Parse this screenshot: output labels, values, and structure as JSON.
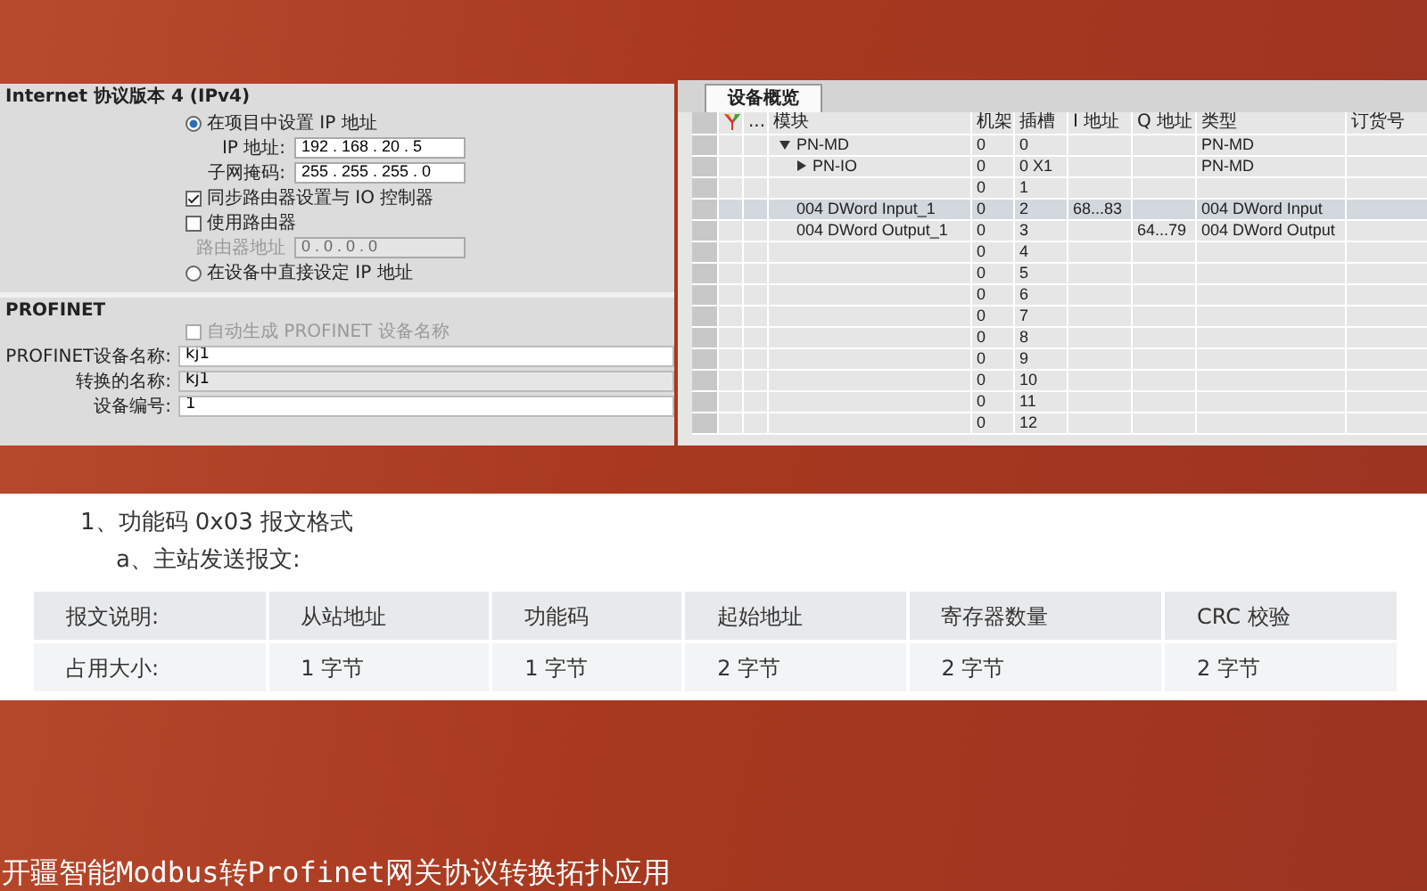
{
  "ip_panel": {
    "sections": [
      {
        "title": "Internet 协议版本 4 (IPv4)",
        "items": [
          {
            "kind": "radio",
            "label": "在项目中设置 IP 地址",
            "selected": true
          },
          {
            "kind": "ip_field",
            "label": "IP 地址:",
            "value": "192 . 168 . 20 . 5",
            "disabled": false
          },
          {
            "kind": "ip_field",
            "label": "子网掩码:",
            "value": "255 . 255 . 255 . 0",
            "disabled": false
          },
          {
            "kind": "checkbox",
            "label": "同步路由器设置与 IO 控制器",
            "checked": true,
            "disabled": false
          },
          {
            "kind": "checkbox",
            "label": "使用路由器",
            "checked": false,
            "disabled": false
          },
          {
            "kind": "ip_field",
            "label": "路由器地址",
            "value": "0 . 0 . 0 . 0",
            "disabled": true
          },
          {
            "kind": "radio",
            "label": "在设备中直接设定 IP 地址",
            "selected": false
          }
        ]
      },
      {
        "title": "PROFINET",
        "items": [
          {
            "kind": "checkbox",
            "label": "自动生成 PROFINET 设备名称",
            "checked": false,
            "disabled": true
          },
          {
            "kind": "text_field",
            "label": "PROFINET设备名称:",
            "value": "kj1",
            "readonly": false
          },
          {
            "kind": "text_field",
            "label": "转换的名称:",
            "value": "kj1",
            "readonly": true
          },
          {
            "kind": "text_field",
            "label": "设备编号:",
            "value": "1",
            "readonly": false
          }
        ]
      }
    ]
  },
  "device_overview": {
    "tabs": [
      {
        "label": "设备概览",
        "selected": true
      }
    ],
    "columns": [
      "...",
      "模块",
      "机架",
      "插槽",
      "I 地址",
      "Q 地址",
      "类型",
      "订货号"
    ],
    "rows": [
      {
        "module": "PN-MD",
        "rack": "0",
        "slot": "0",
        "type": "PN-MD",
        "expanded": true,
        "selected": false,
        "children": [
          {
            "module": "PN-IO",
            "rack": "0",
            "slot": "0 X1",
            "type": "PN-MD",
            "expanded": false,
            "selected": false
          },
          {
            "rack": "0",
            "slot": "1",
            "selected": false
          },
          {
            "module": "004 DWord Input_1",
            "rack": "0",
            "slot": "2",
            "i_address": "68...83",
            "type": "004 DWord Input",
            "selected": true
          },
          {
            "module": "004 DWord Output_1",
            "rack": "0",
            "slot": "3",
            "q_address": "64...79",
            "type": "004 DWord Output",
            "selected": false
          },
          {
            "rack": "0",
            "slot": "4",
            "selected": false
          },
          {
            "rack": "0",
            "slot": "5",
            "selected": false
          },
          {
            "rack": "0",
            "slot": "6",
            "selected": false
          },
          {
            "rack": "0",
            "slot": "7",
            "selected": false
          },
          {
            "rack": "0",
            "slot": "8",
            "selected": false
          },
          {
            "rack": "0",
            "slot": "9",
            "selected": false
          },
          {
            "rack": "0",
            "slot": "10",
            "selected": false
          },
          {
            "rack": "0",
            "slot": "11",
            "selected": false
          },
          {
            "rack": "0",
            "slot": "12",
            "selected": false
          }
        ]
      }
    ]
  },
  "document": {
    "heading": "1、功能码 0x03 报文格式",
    "subheading": "a、主站发送报文:",
    "table": {
      "columns": [
        "报文说明:",
        "从站地址",
        "功能码",
        "起始地址",
        "寄存器数量",
        "CRC 校验"
      ],
      "rows": [
        [
          "占用大小:",
          "1 字节",
          "1 字节",
          "2 字节",
          "2 字节",
          "2 字节"
        ]
      ]
    }
  },
  "caption": "开疆智能Modbus转Profinet网关协议转换拓扑应用"
}
